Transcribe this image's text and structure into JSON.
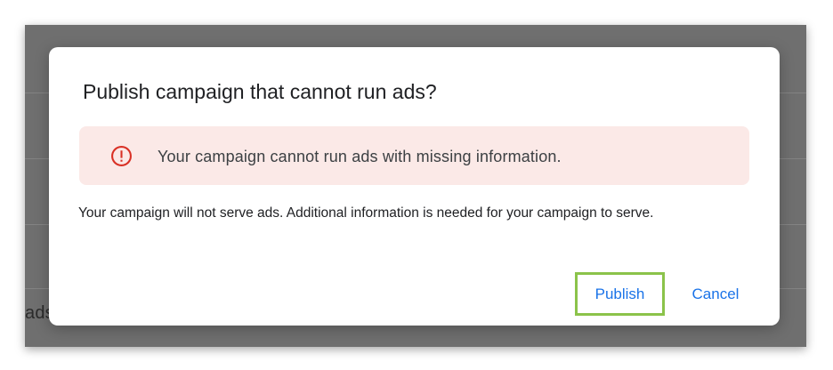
{
  "background_page": {
    "visible_fragment_text": "ads"
  },
  "dialog": {
    "title": "Publish campaign that cannot run ads?",
    "alert": {
      "icon": "error-outline-icon",
      "message": "Your campaign cannot run ads with missing information."
    },
    "body": "Your campaign will not serve ads. Additional information is needed for your campaign to serve.",
    "buttons": {
      "publish_label": "Publish",
      "cancel_label": "Cancel"
    }
  },
  "colors": {
    "accent": "#1a73e8",
    "alert_background": "#fbe9e7",
    "error_icon": "#d93025",
    "highlight_outline": "#8bc34a",
    "scrim": "#6f6f6f"
  }
}
